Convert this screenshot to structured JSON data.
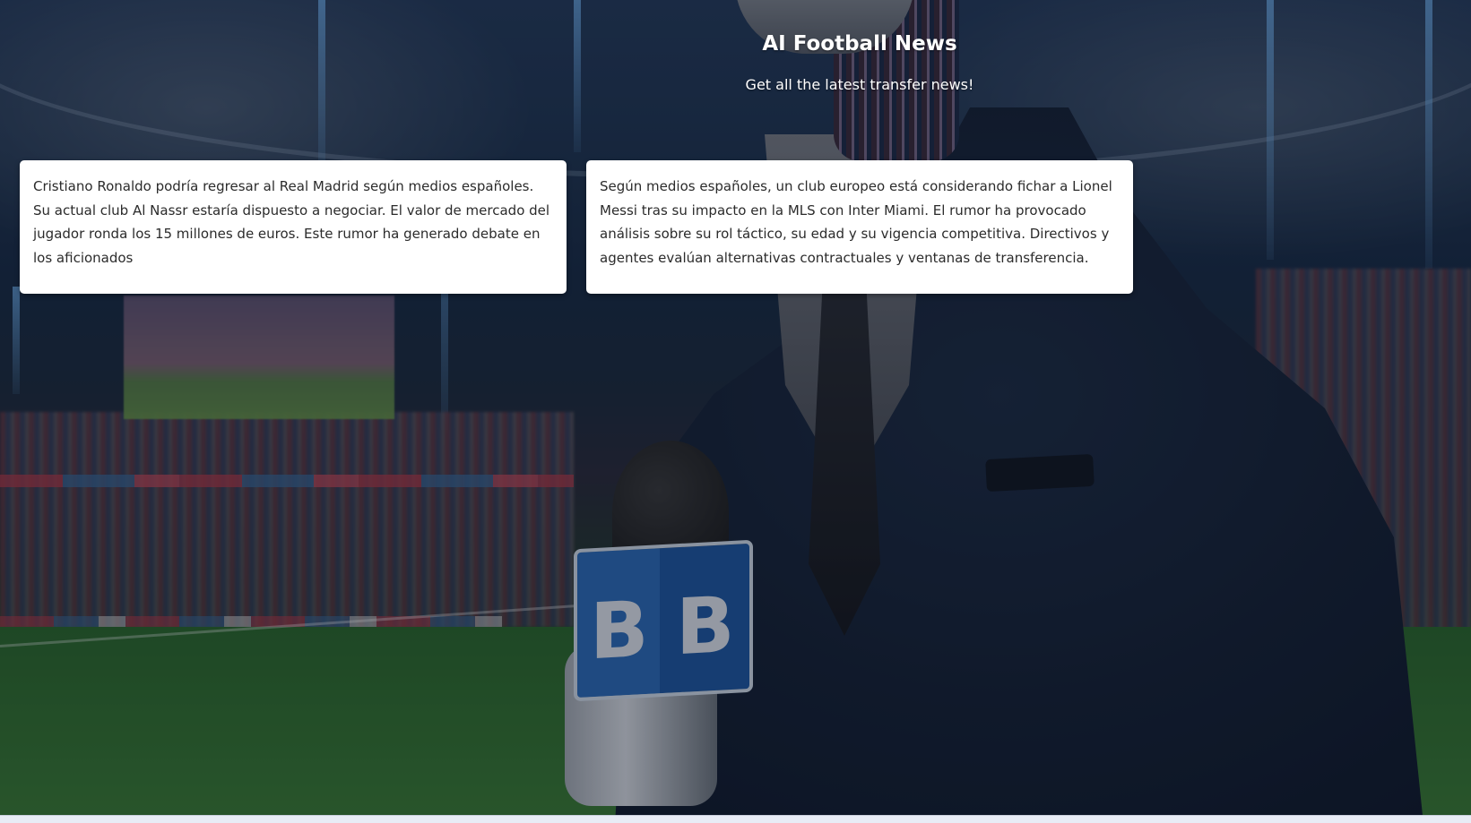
{
  "page": {
    "title": "AI Football News",
    "subtitle": "Get all the latest transfer news!"
  },
  "news": [
    {
      "text": "Cristiano Ronaldo podría regresar al Real Madrid según medios españoles. Su actual club Al Nassr estaría dispuesto a negociar. El valor de mercado del jugador ronda los 15 millones de euros. Este rumor ha generado debate en los aficionados"
    },
    {
      "text": "Según medios españoles, un club europeo está considerando fichar a Lionel Messi tras su impacto en la MLS con Inter Miami. El rumor ha provocado análisis sobre su rol táctico, su edad y su vigencia competitiva. Directivos y agentes evalúan alternativas contractuales y ventanas de transferencia."
    }
  ],
  "background": {
    "microphone_logo": "B"
  }
}
